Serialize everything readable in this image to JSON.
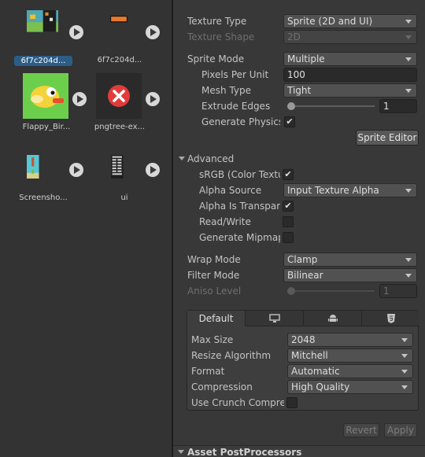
{
  "project_assets": [
    {
      "name": "6f7c204d...",
      "selected": true
    },
    {
      "name": "6f7c204d...",
      "selected": false
    },
    {
      "name": "Flappy_Bir...",
      "selected": false
    },
    {
      "name": "pngtree-ex...",
      "selected": false
    },
    {
      "name": "Screensho...",
      "selected": false
    },
    {
      "name": "ui",
      "selected": false
    }
  ],
  "inspector": {
    "texture_type": {
      "label": "Texture Type",
      "value": "Sprite (2D and UI)"
    },
    "texture_shape": {
      "label": "Texture Shape",
      "value": "2D"
    },
    "sprite_mode": {
      "label": "Sprite Mode",
      "value": "Multiple"
    },
    "pixels_per_unit": {
      "label": "Pixels Per Unit",
      "value": "100"
    },
    "mesh_type": {
      "label": "Mesh Type",
      "value": "Tight"
    },
    "extrude_edges": {
      "label": "Extrude Edges",
      "value": "1"
    },
    "generate_physics": {
      "label": "Generate Physics Shape",
      "checked_mark": "✔"
    },
    "sprite_editor_button": "Sprite Editor",
    "advanced": {
      "title": "Advanced",
      "srgb": {
        "label": "sRGB (Color Texture)",
        "checked_mark": "✔"
      },
      "alpha_source": {
        "label": "Alpha Source",
        "value": "Input Texture Alpha"
      },
      "alpha_is_transparency": {
        "label": "Alpha Is Transparency",
        "checked_mark": "✔"
      },
      "read_write": {
        "label": "Read/Write"
      },
      "generate_mipmaps": {
        "label": "Generate Mipmaps"
      }
    },
    "wrap_mode": {
      "label": "Wrap Mode",
      "value": "Clamp"
    },
    "filter_mode": {
      "label": "Filter Mode",
      "value": "Bilinear"
    },
    "aniso_level": {
      "label": "Aniso Level",
      "value": "1"
    },
    "platform": {
      "tabs": [
        {
          "label": "Default",
          "icon": "default"
        },
        {
          "label": "",
          "icon": "monitor-icon"
        },
        {
          "label": "",
          "icon": "android-icon"
        },
        {
          "label": "",
          "icon": "html5-icon"
        }
      ],
      "max_size": {
        "label": "Max Size",
        "value": "2048"
      },
      "resize_algorithm": {
        "label": "Resize Algorithm",
        "value": "Mitchell"
      },
      "format": {
        "label": "Format",
        "value": "Automatic"
      },
      "compression": {
        "label": "Compression",
        "value": "High Quality"
      },
      "use_crunch": {
        "label": "Use Crunch Compression"
      }
    },
    "revert_button": "Revert",
    "apply_button": "Apply",
    "asset_postprocessors": "Asset PostProcessors"
  },
  "colors": {
    "selection": "#2c5d87",
    "panel_bg": "#383838",
    "left_bg": "#333333"
  }
}
